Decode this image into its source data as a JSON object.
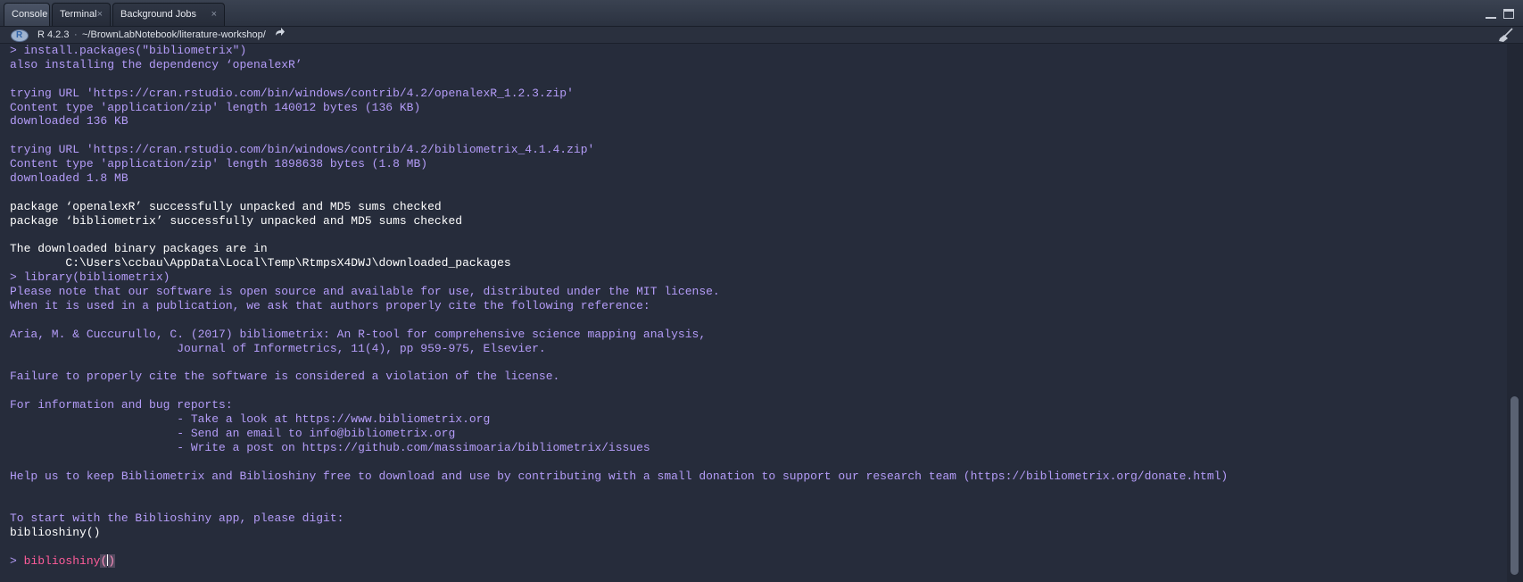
{
  "tabs": [
    {
      "label": "Console",
      "closable": false,
      "active": true
    },
    {
      "label": "Terminal",
      "closable": true,
      "active": false
    },
    {
      "label": "Background Jobs",
      "closable": true,
      "active": false
    }
  ],
  "tab_close_glyph": "×",
  "toolbar": {
    "r_version": "R 4.2.3",
    "separator": "·",
    "working_dir": "~/BrownLabNotebook/literature-workshop/",
    "goto_icon": "arrow-share-icon",
    "clear_icon": "broom-icon"
  },
  "colors": {
    "background": "#262c3b",
    "output_purple": "#b49cf8",
    "output_white": "#ffffff",
    "input_pink": "#ff5c9a"
  },
  "console": {
    "lines": [
      {
        "kind": "input",
        "text": "> install.packages(\"bibliometrix\")"
      },
      {
        "kind": "msg",
        "text": "also installing the dependency ‘openalexR’"
      },
      {
        "kind": "blank",
        "text": ""
      },
      {
        "kind": "msg",
        "text": "trying URL 'https://cran.rstudio.com/bin/windows/contrib/4.2/openalexR_1.2.3.zip'"
      },
      {
        "kind": "msg",
        "text": "Content type 'application/zip' length 140012 bytes (136 KB)"
      },
      {
        "kind": "msg",
        "text": "downloaded 136 KB"
      },
      {
        "kind": "blank",
        "text": ""
      },
      {
        "kind": "msg",
        "text": "trying URL 'https://cran.rstudio.com/bin/windows/contrib/4.2/bibliometrix_4.1.4.zip'"
      },
      {
        "kind": "msg",
        "text": "Content type 'application/zip' length 1898638 bytes (1.8 MB)"
      },
      {
        "kind": "msg",
        "text": "downloaded 1.8 MB"
      },
      {
        "kind": "blank",
        "text": ""
      },
      {
        "kind": "out",
        "text": "package ‘openalexR’ successfully unpacked and MD5 sums checked"
      },
      {
        "kind": "out",
        "text": "package ‘bibliometrix’ successfully unpacked and MD5 sums checked"
      },
      {
        "kind": "blank",
        "text": ""
      },
      {
        "kind": "out",
        "text": "The downloaded binary packages are in"
      },
      {
        "kind": "out",
        "text": "        C:\\Users\\ccbau\\AppData\\Local\\Temp\\RtmpsX4DWJ\\downloaded_packages"
      },
      {
        "kind": "input",
        "text": "> library(bibliometrix)"
      },
      {
        "kind": "msg",
        "text": "Please note that our software is open source and available for use, distributed under the MIT license."
      },
      {
        "kind": "msg",
        "text": "When it is used in a publication, we ask that authors properly cite the following reference:"
      },
      {
        "kind": "blank",
        "text": ""
      },
      {
        "kind": "msg",
        "text": "Aria, M. & Cuccurullo, C. (2017) bibliometrix: An R-tool for comprehensive science mapping analysis,"
      },
      {
        "kind": "msg",
        "text": "                        Journal of Informetrics, 11(4), pp 959-975, Elsevier."
      },
      {
        "kind": "blank",
        "text": ""
      },
      {
        "kind": "msg",
        "text": "Failure to properly cite the software is considered a violation of the license."
      },
      {
        "kind": "blank",
        "text": ""
      },
      {
        "kind": "msg",
        "text": "For information and bug reports:"
      },
      {
        "kind": "msg",
        "text": "                        - Take a look at https://www.bibliometrix.org"
      },
      {
        "kind": "msg",
        "text": "                        - Send an email to info@bibliometrix.org"
      },
      {
        "kind": "msg",
        "text": "                        - Write a post on https://github.com/massimoaria/bibliometrix/issues"
      },
      {
        "kind": "blank",
        "text": ""
      },
      {
        "kind": "msg",
        "text": "Help us to keep Bibliometrix and Biblioshiny free to download and use by contributing with a small donation to support our research team (https://bibliometrix.org/donate.html)"
      },
      {
        "kind": "blank",
        "text": ""
      },
      {
        "kind": "blank",
        "text": ""
      },
      {
        "kind": "msg",
        "text": "To start with the Biblioshiny app, please digit:"
      },
      {
        "kind": "out",
        "text": "biblioshiny()"
      },
      {
        "kind": "blank",
        "text": ""
      }
    ],
    "current_input": {
      "prompt": "> ",
      "command": "biblioshiny",
      "bracket_open": "(",
      "bracket_close": ")"
    }
  }
}
